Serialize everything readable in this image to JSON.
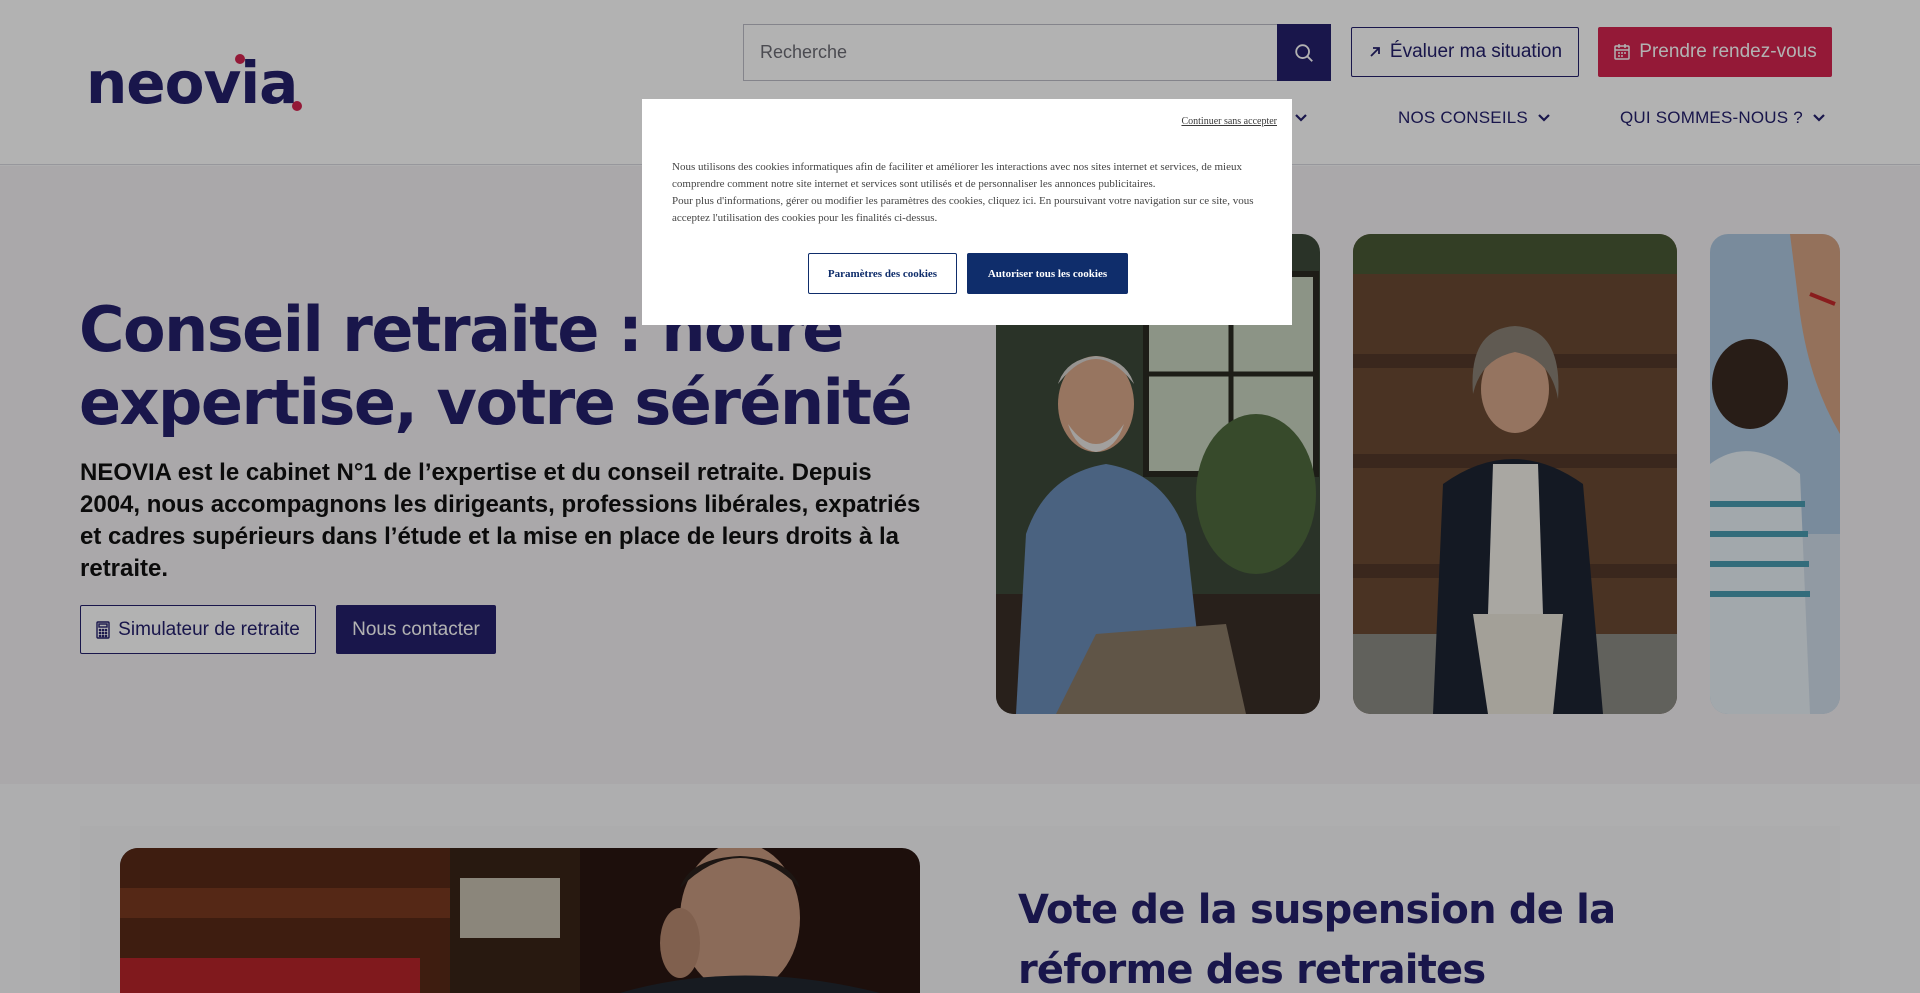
{
  "header": {
    "logo_text": "neovia",
    "search_placeholder": "Recherche",
    "evaluate_label": "Évaluer ma situation",
    "appointment_label": "Prendre rendez-vous",
    "nav": [
      {
        "label": "NOS CONSEILS"
      },
      {
        "label": "QUI SOMMES-NOUS ?"
      }
    ]
  },
  "hero": {
    "title": "Conseil retraite : notre expertise, votre sérénité",
    "subtitle": "NEOVIA est le cabinet N°1 de l’expertise et du conseil retraite. Depuis 2004, nous accompagnons les dirigeants, professions libérales, expatriés et cadres supérieurs dans l’étude et la mise en place de leurs droits à la retraite.",
    "simulator_label": "Simulateur de retraite",
    "contact_label": "Nous contacter"
  },
  "news": {
    "title": "Vote de la suspension de la réforme des retraites"
  },
  "cookie_modal": {
    "continue_label": "Continuer sans accepter",
    "text_line1": "Nous utilisons des cookies informatiques afin de faciliter et améliorer les interactions avec nos sites internet et services, de mieux comprendre comment notre site internet et services sont utilisés et de personnaliser les annonces publicitaires.",
    "text_line2": "Pour plus d'informations, gérer ou modifier les paramètres des cookies, cliquez ici. En poursuivant votre navigation sur ce site, vous acceptez l'utilisation des cookies pour les finalités ci-dessus.",
    "params_label": "Paramètres des cookies",
    "accept_label": "Autoriser tous les cookies"
  },
  "colors": {
    "brand_navy": "#24206c",
    "brand_red": "#d4244f",
    "cookie_blue": "#0f2d6b"
  }
}
